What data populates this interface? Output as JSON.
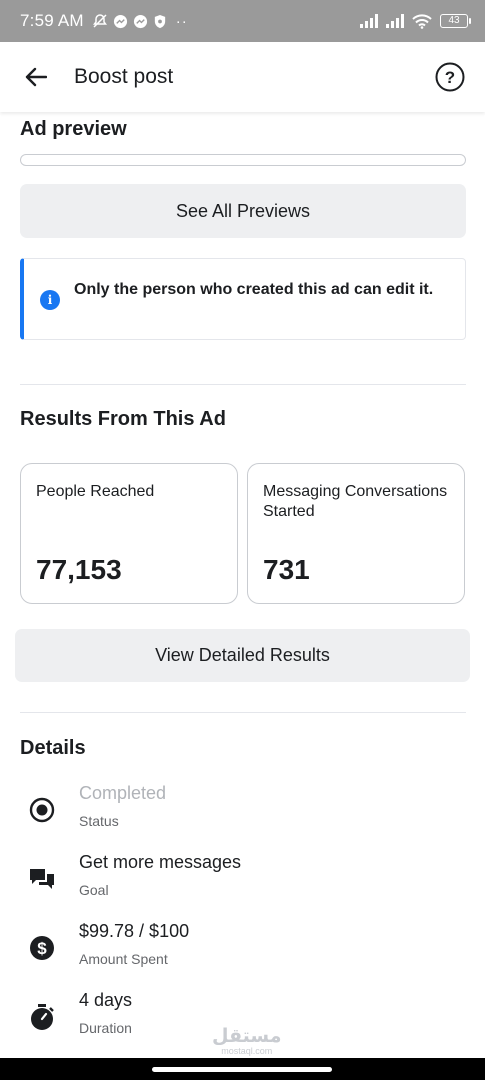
{
  "status_bar": {
    "time": "7:59 AM",
    "battery": "43",
    "icons": [
      "mute-icon",
      "messenger-icon",
      "messenger-icon",
      "shield-icon",
      "more-dots-icon",
      "signal-icon",
      "signal-icon",
      "wifi-icon",
      "battery-icon"
    ]
  },
  "header": {
    "title": "Boost post",
    "help_symbol": "?"
  },
  "preview": {
    "title": "Ad preview",
    "see_all_label": "See All Previews"
  },
  "notice": {
    "icon_symbol": "i",
    "text": "Only the person who created this ad can edit it."
  },
  "results": {
    "title": "Results From This Ad",
    "cards": [
      {
        "label": "People Reached",
        "value": "77,153"
      },
      {
        "label": "Messaging Conversations Started",
        "value": "731"
      }
    ],
    "view_detailed_label": "View Detailed Results"
  },
  "details": {
    "title": "Details",
    "items": [
      {
        "icon": "radio-selected-icon",
        "value": "Completed",
        "label": "Status"
      },
      {
        "icon": "chat-bubbles-icon",
        "value": "Get more messages",
        "label": "Goal"
      },
      {
        "icon": "dollar-icon",
        "value": "$99.78 / $100",
        "label": "Amount Spent"
      },
      {
        "icon": "stopwatch-icon",
        "value": "4 days",
        "label": "Duration"
      }
    ]
  },
  "watermark": {
    "arabic": "مستقل",
    "domain": "mostaql.com"
  },
  "colors": {
    "accent": "#1877f2",
    "status_bar": "#9a9a9a",
    "button_bg": "#eeeff1",
    "muted_text": "#b0b3b8"
  }
}
